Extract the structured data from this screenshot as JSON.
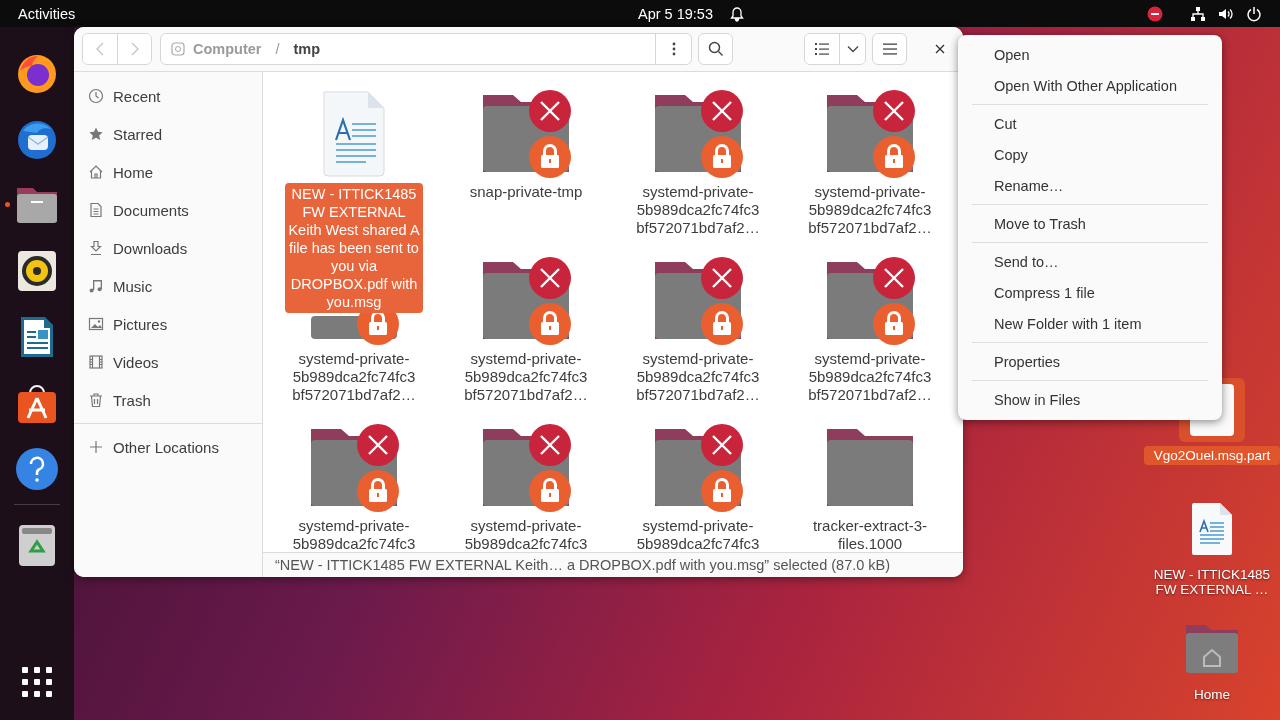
{
  "top_bar": {
    "activities": "Activities",
    "clock": "Apr 5  19:53"
  },
  "dock": [
    {
      "kind": "browser",
      "running": false
    },
    {
      "kind": "mail",
      "running": false
    },
    {
      "kind": "files",
      "running": true
    },
    {
      "kind": "music",
      "running": false
    },
    {
      "kind": "writer",
      "running": false
    },
    {
      "kind": "store",
      "running": false
    },
    {
      "kind": "help",
      "running": false
    },
    {
      "kind": "trash",
      "running": false
    },
    {
      "kind": "apps",
      "running": false
    }
  ],
  "window": {
    "path": {
      "segments": [
        "Computer",
        "tmp"
      ],
      "separator": "/"
    }
  },
  "sidebar": {
    "items": [
      {
        "label": "Recent",
        "kind": "recent",
        "selected": false
      },
      {
        "label": "Starred",
        "kind": "starred",
        "selected": false
      },
      {
        "label": "Home",
        "kind": "home",
        "selected": false
      },
      {
        "label": "Documents",
        "kind": "documents",
        "selected": false
      },
      {
        "label": "Downloads",
        "kind": "downloads",
        "selected": false
      },
      {
        "label": "Music",
        "kind": "music",
        "selected": false
      },
      {
        "label": "Pictures",
        "kind": "pictures",
        "selected": false
      },
      {
        "label": "Videos",
        "kind": "videos",
        "selected": false
      },
      {
        "label": "Trash",
        "kind": "trash",
        "selected": false
      }
    ],
    "other": {
      "label": "Other Locations",
      "selected": false
    }
  },
  "files": [
    {
      "name": "NEW - ITTICK1485 FW EXTERNAL Keith West shared A file has been sent to you via DROPBOX.pdf with you.msg",
      "kind": "document",
      "locked": false,
      "selected": true
    },
    {
      "name": "snap-private-tmp",
      "kind": "folder",
      "locked": true,
      "selected": false
    },
    {
      "name": "systemd-private-5b989dca2fc74fc3bf572071bd7af2…",
      "kind": "folder",
      "locked": true,
      "selected": false
    },
    {
      "name": "systemd-private-5b989dca2fc74fc3bf572071bd7af2…",
      "kind": "folder",
      "locked": true,
      "selected": false
    },
    {
      "name": "systemd-private-5b989dca2fc74fc3bf572071bd7af2…",
      "kind": "folder",
      "locked": true,
      "selected": false
    },
    {
      "name": "systemd-private-5b989dca2fc74fc3bf572071bd7af2…",
      "kind": "folder",
      "locked": true,
      "selected": false
    },
    {
      "name": "systemd-private-5b989dca2fc74fc3bf572071bd7af2…",
      "kind": "folder",
      "locked": true,
      "selected": false
    },
    {
      "name": "systemd-private-5b989dca2fc74fc3bf572071bd7af2…",
      "kind": "folder",
      "locked": true,
      "selected": false
    },
    {
      "name": "systemd-private-5b989dca2fc74fc3",
      "kind": "folder",
      "locked": true,
      "selected": false
    },
    {
      "name": "systemd-private-5b989dca2fc74fc3",
      "kind": "folder",
      "locked": true,
      "selected": false
    },
    {
      "name": "systemd-private-5b989dca2fc74fc3",
      "kind": "folder",
      "locked": true,
      "selected": false
    },
    {
      "name": "tracker-extract-3-files.1000",
      "kind": "folder",
      "locked": false,
      "selected": false
    }
  ],
  "status_bar": "“NEW - ITTICK1485 FW EXTERNAL Keith… a DROPBOX.pdf with you.msg” selected (87.0 kB)",
  "context_menu": {
    "sections": [
      [
        "Open",
        "Open With Other Application"
      ],
      [
        "Cut",
        "Copy",
        "Rename…"
      ],
      [
        "Move to Trash"
      ],
      [
        "Send to…",
        "Compress 1 file",
        "New Folder with 1 item"
      ],
      [
        "Properties"
      ],
      [
        "Show in Files"
      ]
    ]
  },
  "desktop_icons": [
    {
      "name": "Vgo2Ouel.msg.part",
      "kind": "file",
      "selected": true
    },
    {
      "name": "NEW - ITTICK1485 FW EXTERNAL …",
      "kind": "document",
      "selected": false
    },
    {
      "name": "Home",
      "kind": "home",
      "selected": false
    }
  ]
}
